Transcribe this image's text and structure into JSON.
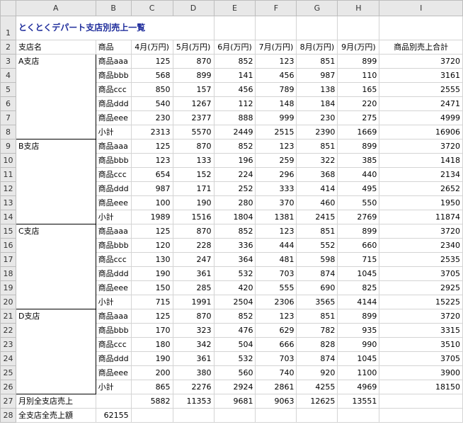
{
  "columns": [
    "A",
    "B",
    "C",
    "D",
    "E",
    "F",
    "G",
    "H",
    "I"
  ],
  "title": "とくとくデパート支店別売上一覧",
  "header": [
    "支店名",
    "商品",
    "4月(万円)",
    "5月(万円)",
    "6月(万円)",
    "7月(万円)",
    "8月(万円)",
    "9月(万円)",
    "商品別売上合計"
  ],
  "branches": [
    {
      "name": "A支店",
      "rows": [
        {
          "product": "商品aaa",
          "values": [
            125,
            870,
            852,
            123,
            851,
            899
          ],
          "total": 3720
        },
        {
          "product": "商品bbb",
          "values": [
            568,
            899,
            141,
            456,
            987,
            110
          ],
          "total": 3161
        },
        {
          "product": "商品ccc",
          "values": [
            850,
            157,
            456,
            789,
            138,
            165
          ],
          "total": 2555
        },
        {
          "product": "商品ddd",
          "values": [
            540,
            1267,
            112,
            148,
            184,
            220
          ],
          "total": 2471
        },
        {
          "product": "商品eee",
          "values": [
            230,
            2377,
            888,
            999,
            230,
            275
          ],
          "total": 4999
        },
        {
          "product": "小計",
          "values": [
            2313,
            5570,
            2449,
            2515,
            2390,
            1669
          ],
          "total": 16906
        }
      ]
    },
    {
      "name": "B支店",
      "rows": [
        {
          "product": "商品aaa",
          "values": [
            125,
            870,
            852,
            123,
            851,
            899
          ],
          "total": 3720
        },
        {
          "product": "商品bbb",
          "values": [
            123,
            133,
            196,
            259,
            322,
            385
          ],
          "total": 1418
        },
        {
          "product": "商品ccc",
          "values": [
            654,
            152,
            224,
            296,
            368,
            440
          ],
          "total": 2134
        },
        {
          "product": "商品ddd",
          "values": [
            987,
            171,
            252,
            333,
            414,
            495
          ],
          "total": 2652
        },
        {
          "product": "商品eee",
          "values": [
            100,
            190,
            280,
            370,
            460,
            550
          ],
          "total": 1950
        },
        {
          "product": "小計",
          "values": [
            1989,
            1516,
            1804,
            1381,
            2415,
            2769
          ],
          "total": 11874
        }
      ]
    },
    {
      "name": "C支店",
      "rows": [
        {
          "product": "商品aaa",
          "values": [
            125,
            870,
            852,
            123,
            851,
            899
          ],
          "total": 3720
        },
        {
          "product": "商品bbb",
          "values": [
            120,
            228,
            336,
            444,
            552,
            660
          ],
          "total": 2340
        },
        {
          "product": "商品ccc",
          "values": [
            130,
            247,
            364,
            481,
            598,
            715
          ],
          "total": 2535
        },
        {
          "product": "商品ddd",
          "values": [
            190,
            361,
            532,
            703,
            874,
            1045
          ],
          "total": 3705
        },
        {
          "product": "商品eee",
          "values": [
            150,
            285,
            420,
            555,
            690,
            825
          ],
          "total": 2925
        },
        {
          "product": "小計",
          "values": [
            715,
            1991,
            2504,
            2306,
            3565,
            4144
          ],
          "total": 15225
        }
      ]
    },
    {
      "name": "D支店",
      "rows": [
        {
          "product": "商品aaa",
          "values": [
            125,
            870,
            852,
            123,
            851,
            899
          ],
          "total": 3720
        },
        {
          "product": "商品bbb",
          "values": [
            170,
            323,
            476,
            629,
            782,
            935
          ],
          "total": 3315
        },
        {
          "product": "商品ccc",
          "values": [
            180,
            342,
            504,
            666,
            828,
            990
          ],
          "total": 3510
        },
        {
          "product": "商品ddd",
          "values": [
            190,
            361,
            532,
            703,
            874,
            1045
          ],
          "total": 3705
        },
        {
          "product": "商品eee",
          "values": [
            200,
            380,
            560,
            740,
            920,
            1100
          ],
          "total": 3900
        },
        {
          "product": "小計",
          "values": [
            865,
            2276,
            2924,
            2861,
            4255,
            4969
          ],
          "total": 18150
        }
      ]
    }
  ],
  "monthly_total": {
    "label": "月別全支店売上",
    "values": [
      5882,
      11353,
      9681,
      9063,
      12625,
      13551
    ]
  },
  "grand_total": {
    "label": "全支店全売上額",
    "value": 62155
  }
}
